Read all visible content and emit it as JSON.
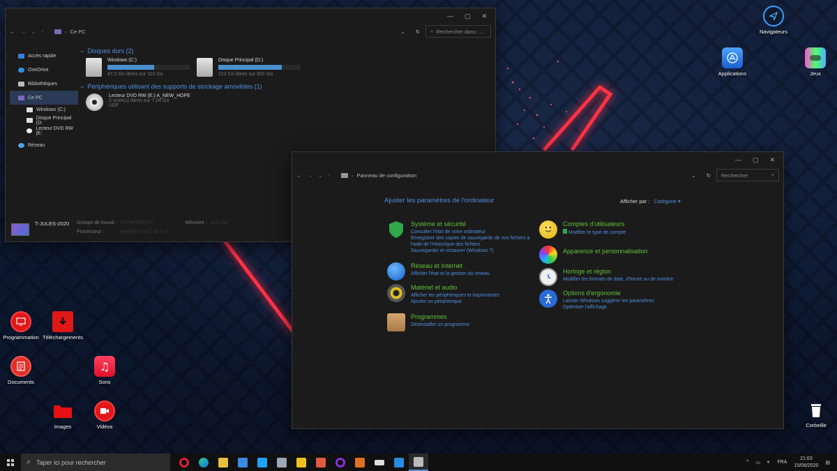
{
  "desktop": {
    "icons": {
      "navigateurs": "Navigateurs",
      "applications": "Applications",
      "jeux": "Jeux",
      "programmation": "Programmation",
      "telechargements": "Téléchargements",
      "documents": "Documents",
      "sons": "Sons",
      "images": "Images",
      "videos": "Vidéos",
      "corbeille": "Corbeille"
    }
  },
  "explorer": {
    "address": "Ce PC",
    "search_placeholder": "Rechercher dans : ...",
    "sidebar": [
      {
        "label": "Accès rapide"
      },
      {
        "label": "OneDrive"
      },
      {
        "label": "Bibliothèques"
      },
      {
        "label": "Ce PC"
      },
      {
        "label": "Windows (C:)"
      },
      {
        "label": "Disque Principal (D:"
      },
      {
        "label": "Lecteur DVD RW (E:"
      },
      {
        "label": "Réseau"
      }
    ],
    "section_drives": "Disques durs (2)",
    "section_removable": "Périphériques utilisant des supports de stockage amovibles (1)",
    "drives": [
      {
        "name": "Windows (C:)",
        "free": "47,0 Go libres sur 110 Go",
        "used_fraction": 0.57
      },
      {
        "name": "Disque Principal (D:)",
        "free": "213 Go libres sur 931 Go",
        "used_fraction": 0.77
      }
    ],
    "dvd": {
      "name": "Lecteur DVD RW (E:) A_NEW_HOPE",
      "free": "0 octet(s) libres sur 7,04 Go",
      "fs": "UDF"
    },
    "status": {
      "computer": "T-JULES-2020",
      "workgroup_label": "Groupe de travail :",
      "workgroup": "WORKGROUP",
      "memory_label": "Mémoire :",
      "memory": "8,00 Go",
      "cpu_label": "Processeur :",
      "cpu": "Intel(R) Core(TM) i5-7..."
    }
  },
  "control_panel": {
    "address": "Panneau de configuration",
    "search_placeholder": "Rechercher",
    "heading": "Ajuster les paramètres de l'ordinateur",
    "view_by_label": "Afficher par :",
    "view_by_value": "Catégorie",
    "categories": [
      {
        "title": "Système et sécurité",
        "links": [
          "Consulter l'état de votre ordinateur",
          "Enregistrer des copies de sauvegarde de vos fichiers à l'aide de l'Historique des fichiers",
          "Sauvegarder et restaurer (Windows 7)"
        ]
      },
      {
        "title": "Réseau et Internet",
        "links": [
          "Afficher l'état et la gestion du réseau"
        ]
      },
      {
        "title": "Matériel et audio",
        "links": [
          "Afficher les périphériques et imprimantes",
          "Ajouter un périphérique"
        ]
      },
      {
        "title": "Programmes",
        "links": [
          "Désinstaller un programme"
        ]
      },
      {
        "title": "Comptes d'utilisateurs",
        "links": [
          "Modifier le type de compte"
        ]
      },
      {
        "title": "Apparence et personnalisation",
        "links": []
      },
      {
        "title": "Horloge et région",
        "links": [
          "Modifier les formats de date, d'heure ou de nombre"
        ]
      },
      {
        "title": "Options d'ergonomie",
        "links": [
          "Laisser Windows suggérer les paramètres",
          "Optimiser l'affichage"
        ]
      }
    ]
  },
  "taskbar": {
    "search_placeholder": "Taper ici pour rechercher",
    "lang": "FRA",
    "time": "21:03",
    "date": "15/08/2020"
  },
  "colors": {
    "accent": "#4f8fe0",
    "category_title": "#5ec23a",
    "neon": "#ff2a3d"
  }
}
